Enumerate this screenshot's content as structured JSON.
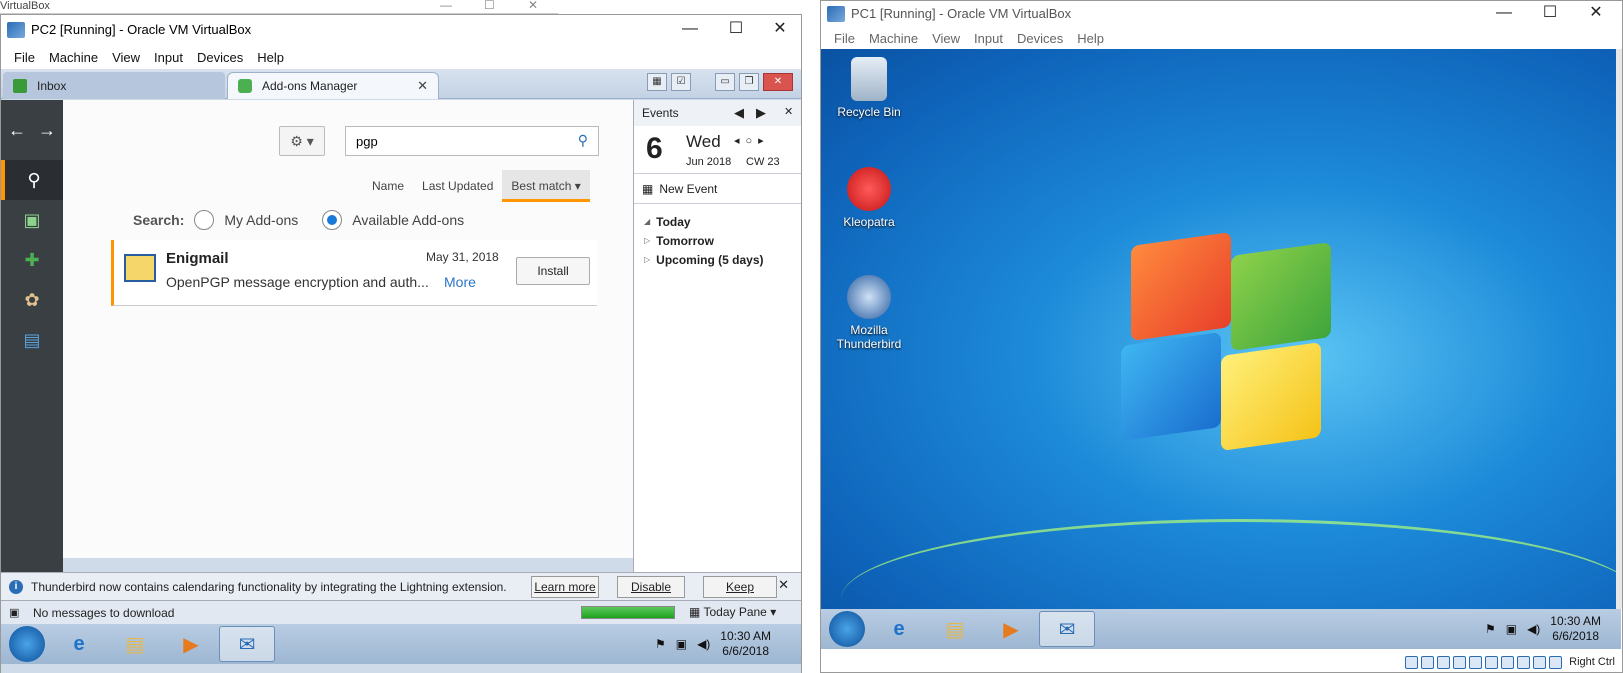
{
  "host": {
    "strip_title": "VirtualBox"
  },
  "pc2": {
    "title": "PC2 [Running] - Oracle VM VirtualBox",
    "menu": [
      "File",
      "Machine",
      "View",
      "Input",
      "Devices",
      "Help"
    ],
    "tabs": {
      "inbox": "Inbox",
      "addons": "Add-ons Manager"
    },
    "search": {
      "value": "pgp"
    },
    "sort": {
      "name": "Name",
      "updated": "Last Updated",
      "best": "Best match"
    },
    "filter": {
      "label": "Search:",
      "mine": "My Add-ons",
      "available": "Available Add-ons"
    },
    "addon": {
      "name": "Enigmail",
      "date": "May 31, 2018",
      "description": "OpenPGP message encryption and auth...",
      "more": "More",
      "install": "Install"
    },
    "events": {
      "title": "Events",
      "day_num": "6",
      "day_name": "Wed",
      "month": "Jun 2018",
      "cw": "CW 23",
      "new_event": "New Event",
      "today": "Today",
      "tomorrow": "Tomorrow",
      "upcoming": "Upcoming (5 days)"
    },
    "notification": {
      "message": "Thunderbird now contains calendaring functionality by integrating the Lightning extension.",
      "learn_more": "Learn more",
      "disable": "Disable",
      "keep": "Keep"
    },
    "status": {
      "message": "No messages to download",
      "progress": 1.0,
      "pane": "Today Pane"
    },
    "clock": {
      "time": "10:30 AM",
      "date": "6/6/2018"
    }
  },
  "pc1": {
    "title": "PC1 [Running] - Oracle VM VirtualBox",
    "menu": [
      "File",
      "Machine",
      "View",
      "Input",
      "Devices",
      "Help"
    ],
    "desktop": {
      "recycle": "Recycle Bin",
      "kleopatra": "Kleopatra",
      "thunderbird_1": "Mozilla",
      "thunderbird_2": "Thunderbird"
    },
    "clock": {
      "time": "10:30 AM",
      "date": "6/6/2018"
    },
    "host_key": "Right Ctrl"
  },
  "colors": {
    "accent": "#ff9500",
    "link": "#2a76c6",
    "radio": "#1a7ad9"
  }
}
